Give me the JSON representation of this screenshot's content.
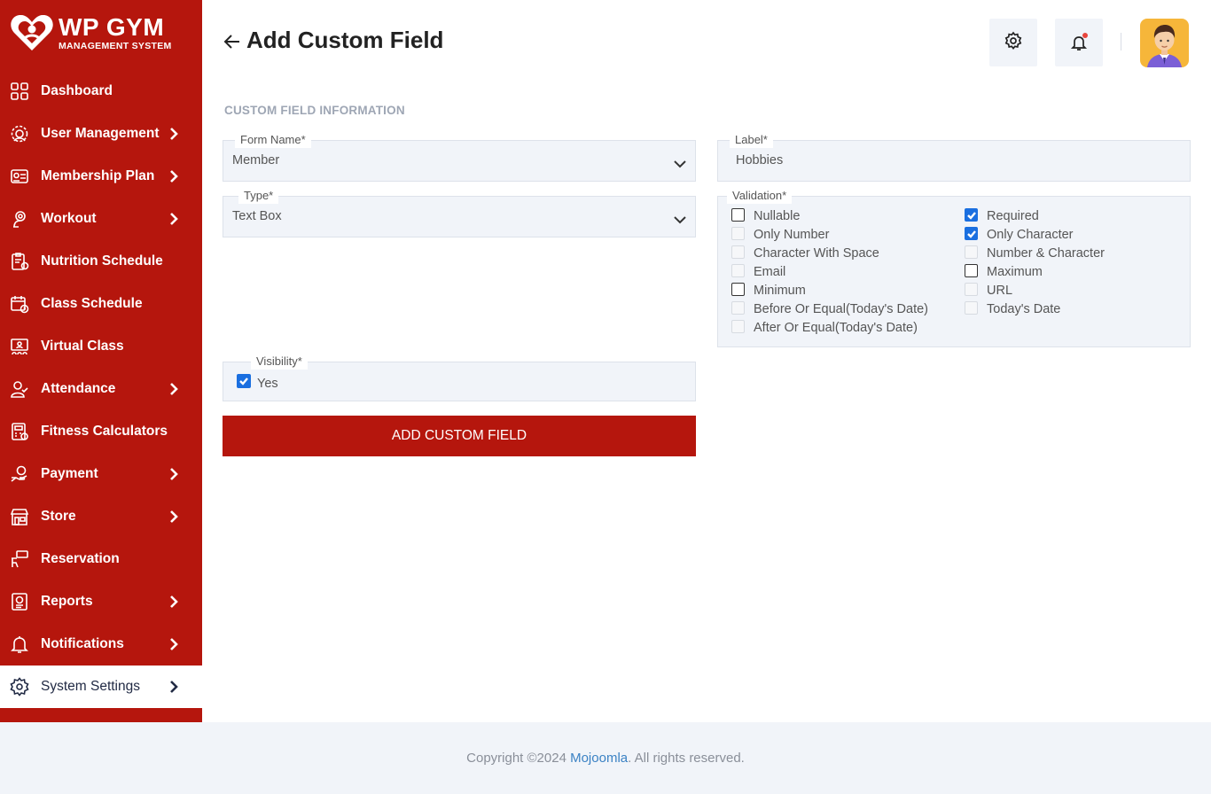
{
  "brand": {
    "title": "WP GYM",
    "subtitle": "MANAGEMENT SYSTEM"
  },
  "sidebar": {
    "items": [
      {
        "label": "Dashboard",
        "icon": "dashboard-grid-icon",
        "has_submenu": false
      },
      {
        "label": "User Management",
        "icon": "users-gear-icon",
        "has_submenu": true
      },
      {
        "label": "Membership Plan",
        "icon": "membership-card-icon",
        "has_submenu": true
      },
      {
        "label": "Workout",
        "icon": "workout-icon",
        "has_submenu": true
      },
      {
        "label": "Nutrition Schedule",
        "icon": "nutrition-clipboard-icon",
        "has_submenu": false
      },
      {
        "label": "Class Schedule",
        "icon": "calendar-clock-icon",
        "has_submenu": false
      },
      {
        "label": "Virtual Class",
        "icon": "virtual-class-icon",
        "has_submenu": false
      },
      {
        "label": "Attendance",
        "icon": "user-check-icon",
        "has_submenu": true
      },
      {
        "label": "Fitness Calculators",
        "icon": "calculator-icon",
        "has_submenu": false
      },
      {
        "label": "Payment",
        "icon": "payment-hand-icon",
        "has_submenu": true
      },
      {
        "label": "Store",
        "icon": "store-icon",
        "has_submenu": true
      },
      {
        "label": "Reservation",
        "icon": "reservation-icon",
        "has_submenu": false
      },
      {
        "label": "Reports",
        "icon": "report-icon",
        "has_submenu": true
      },
      {
        "label": "Notifications",
        "icon": "bell-icon",
        "has_submenu": true
      },
      {
        "label": "System Settings",
        "icon": "gear-icon",
        "has_submenu": true,
        "active": true
      }
    ]
  },
  "header": {
    "title": "Add Custom Field",
    "settings_icon": "gear-icon",
    "notifications_icon": "bell-icon",
    "notification_dot_color": "#e8453c"
  },
  "form": {
    "section_title": "CUSTOM FIELD INFORMATION",
    "form_name": {
      "legend": "Form Name*",
      "value": "Member"
    },
    "type": {
      "legend": "Type*",
      "value": "Text Box"
    },
    "label": {
      "legend": "Label*",
      "value": "Hobbies"
    },
    "validation": {
      "legend": "Validation*",
      "left": [
        {
          "label": "Nullable",
          "state": "unchecked"
        },
        {
          "label": "Only Number",
          "state": "disabled"
        },
        {
          "label": "Character With Space",
          "state": "disabled"
        },
        {
          "label": "Email",
          "state": "disabled"
        },
        {
          "label": "Minimum",
          "state": "unchecked"
        },
        {
          "label": "Before Or Equal(Today's Date)",
          "state": "disabled"
        },
        {
          "label": "After Or Equal(Today's Date)",
          "state": "disabled"
        }
      ],
      "right": [
        {
          "label": "Required",
          "state": "checked"
        },
        {
          "label": "Only Character",
          "state": "checked"
        },
        {
          "label": "Number & Character",
          "state": "disabled"
        },
        {
          "label": "Maximum",
          "state": "unchecked"
        },
        {
          "label": "URL",
          "state": "disabled"
        },
        {
          "label": "Today's Date",
          "state": "disabled"
        }
      ]
    },
    "visibility": {
      "legend": "Visibility*",
      "option": "Yes",
      "checked": true
    },
    "submit_label": "ADD CUSTOM FIELD"
  },
  "footer": {
    "prefix": "Copyright ©2024 ",
    "link": "Mojoomla",
    "suffix": ". All rights reserved."
  },
  "colors": {
    "brand_red": "#b5160d",
    "checkbox_blue": "#1a6fe0",
    "field_bg": "#f1f4f9",
    "link_blue": "#3b82c4"
  }
}
